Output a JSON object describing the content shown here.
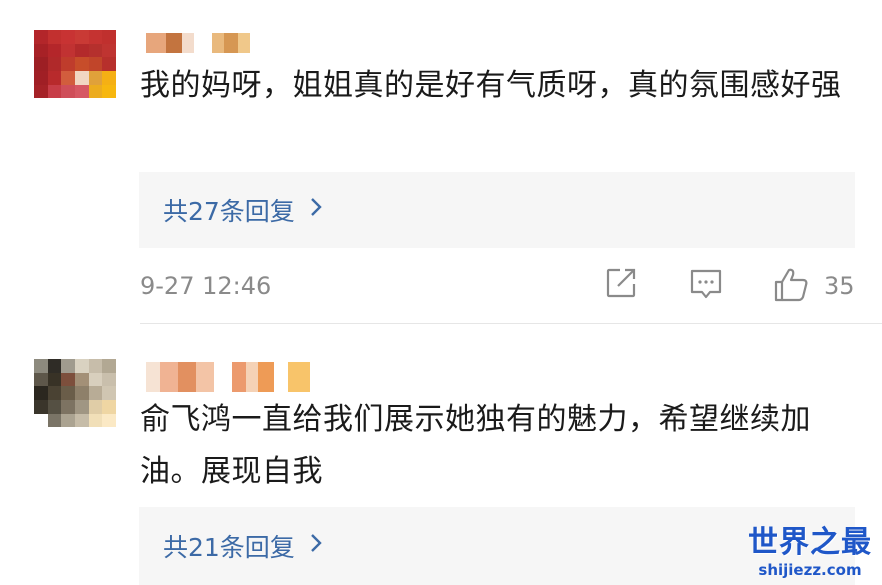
{
  "comments": [
    {
      "text": "我的妈呀，姐姐真的是好有气质呀，真的氛围感好强",
      "reply_label": "共27条回复",
      "timestamp": "9-27 12:46",
      "likes": "35"
    },
    {
      "text": "俞飞鸿一直给我们展示她独有的魅力，希望继续加油。展现自我",
      "reply_label": "共21条回复"
    }
  ],
  "icons": {
    "chevron": "chevron-right-icon",
    "share": "share-icon",
    "comment": "comment-icon",
    "like": "thumbs-up-icon"
  },
  "colors": {
    "link": "#3c6aa6",
    "meta": "#8a8a8a",
    "reply_bg": "#f6f6f6",
    "watermark": "#1f57c8"
  },
  "watermark": {
    "title": "世界之最",
    "url": "shijiezz.com"
  }
}
